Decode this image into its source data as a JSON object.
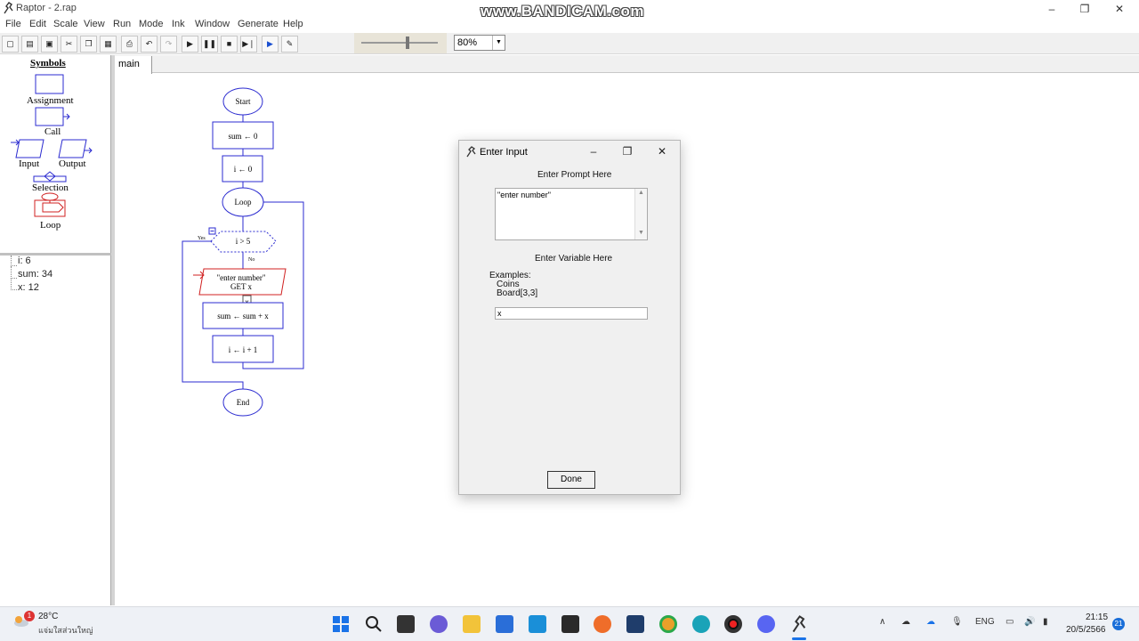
{
  "window": {
    "title": "Raptor - 2.rap",
    "minimize": "–",
    "maximize": "❐",
    "close": "✕"
  },
  "watermark": "www.BANDICAM.com",
  "menu": [
    "File",
    "Edit",
    "Scale",
    "View",
    "Run",
    "Mode",
    "Ink",
    "Window",
    "Generate",
    "Help"
  ],
  "toolbar": {
    "icons": [
      "new-icon",
      "open-icon",
      "save-icon",
      "cut-icon",
      "copy-icon",
      "paste-icon",
      "print-icon",
      "undo-icon",
      "redo-icon",
      "play-icon",
      "pause-icon",
      "stop-icon",
      "step-icon",
      "test-icon",
      "pen-icon"
    ],
    "zoom": "80%"
  },
  "symbols": {
    "title": "Symbols",
    "assignment": "Assignment",
    "call": "Call",
    "input": "Input",
    "output": "Output",
    "selection": "Selection",
    "loop": "Loop"
  },
  "variables": [
    "i: 6",
    "sum: 34",
    "x: 12"
  ],
  "tab": "main",
  "flowchart": {
    "start": "Start",
    "sum_init": "sum ← 0",
    "i_init": "i ← 0",
    "loop": "Loop",
    "condition": "i > 5",
    "yes": "Yes",
    "no": "No",
    "input_prompt": "\"enter number\"",
    "input_get": "GET x",
    "x_marker": "x",
    "sum_update": "sum ← sum + x",
    "i_update": "i ← i + 1",
    "end": "End"
  },
  "dialog": {
    "title": "Enter Input",
    "prompt_label": "Enter Prompt Here",
    "prompt_value": "\"enter number\"",
    "variable_label": "Enter Variable Here",
    "examples_label": "Examples:",
    "example_1": "Coins",
    "example_2": "Board[3,3]",
    "variable_value": "x",
    "done": "Done"
  },
  "taskbar": {
    "weather_temp": "28°C",
    "weather_desc": "แจ่มใสส่วนใหญ่",
    "weather_badge": "1",
    "language": "ENG",
    "time": "21:15",
    "date": "20/5/2566",
    "notification_count": "21"
  }
}
